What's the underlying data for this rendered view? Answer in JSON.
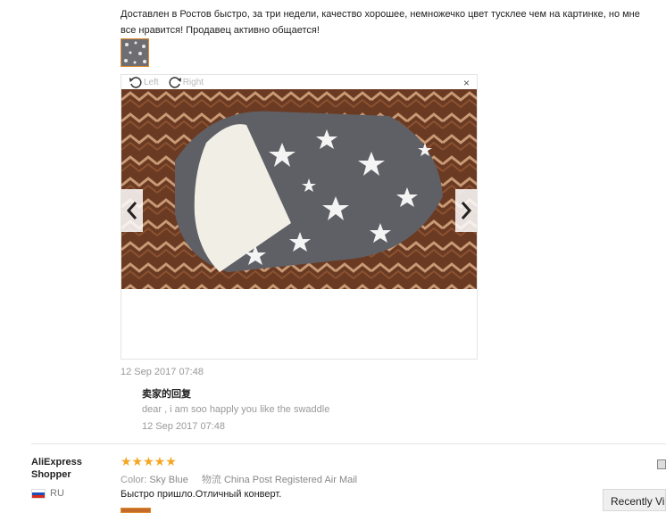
{
  "review1": {
    "text": "Доставлен в Ростов быстро, за три недели, качество хорошее, немножечко цвет тусклее чем на картинке, но мне все нравится! Продавец активно общается!",
    "date": "12 Sep 2017 07:48"
  },
  "viewer": {
    "rotate_left": "Left",
    "rotate_right": "Right",
    "close": "×",
    "prev_icon": "chevron-left-icon",
    "next_icon": "chevron-right-icon"
  },
  "seller_reply": {
    "title": "卖家的回复",
    "text": "dear , i am soo happly you like the swaddle",
    "date": "12 Sep 2017 07:48"
  },
  "review2": {
    "user_line1": "AliExpress",
    "user_line2": "Shopper",
    "country": "RU",
    "stars": "★★★★★",
    "rating": 5,
    "color_label": "Color:",
    "color_value": "Sky Blue",
    "shipping_label": "物流",
    "shipping_value": "China Post Registered Air Mail",
    "text": "Быстро пришло.Отличный конверт."
  },
  "recently_viewed": "Recently Viewed",
  "colors": {
    "accent": "#e08a2e",
    "star": "#f5a623"
  }
}
